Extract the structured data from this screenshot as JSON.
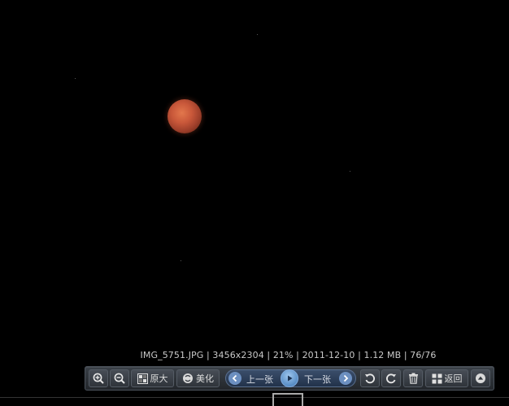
{
  "info_bar": {
    "filename": "IMG_5751.JPG",
    "dimensions": "3456x2304",
    "zoom": "21%",
    "date": "2011-12-10",
    "size": "1.12 MB",
    "position": "76/76",
    "separator": " | "
  },
  "toolbar": {
    "zoom_in_icon": "zoom-in-icon",
    "zoom_out_icon": "zoom-out-icon",
    "actual_size_label": "原大",
    "beautify_label": "美化",
    "prev_label": "上一张",
    "next_label": "下一张",
    "back_label": "返回"
  },
  "colors": {
    "background": "#000000",
    "toolbar": "#2b3036",
    "nav_group": "#2e4260",
    "moon": "#c9583a"
  }
}
